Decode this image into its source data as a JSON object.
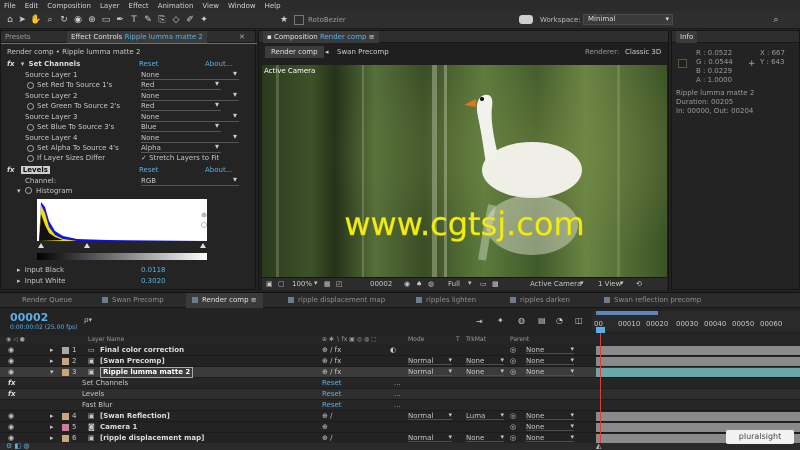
{
  "menu": [
    "File",
    "Edit",
    "Composition",
    "Layer",
    "Effect",
    "Animation",
    "View",
    "Window",
    "Help"
  ],
  "toolbar": {
    "roto_label": "RotoBezier",
    "workspace_label": "Workspace:",
    "workspace_value": "Minimal"
  },
  "effect_controls": {
    "tab_presets": "Presets",
    "tab_title": "Effect Controls",
    "tab_layer": "Ripple lumma matte 2",
    "breadcrumb": "Render comp • Ripple lumma matte 2",
    "set_channels": {
      "name": "Set Channels",
      "reset": "Reset",
      "about": "About...",
      "rows": [
        {
          "label": "Source Layer 1",
          "value": "None"
        },
        {
          "label": "Set Red To Source 1's",
          "value": "Red"
        },
        {
          "label": "Source Layer 2",
          "value": "None"
        },
        {
          "label": "Set Green To Source 2's",
          "value": "Red"
        },
        {
          "label": "Source Layer 3",
          "value": "None"
        },
        {
          "label": "Set Blue To Source 3's",
          "value": "Blue"
        },
        {
          "label": "Source Layer 4",
          "value": "None"
        },
        {
          "label": "Set Alpha To Source 4's",
          "value": "Alpha"
        },
        {
          "label": "If Layer Sizes Differ",
          "value": "✓ Stretch Layers to Fit"
        }
      ]
    },
    "levels": {
      "name": "Levels",
      "reset": "Reset",
      "about": "About...",
      "channel_label": "Channel:",
      "channel_value": "RGB",
      "histogram_label": "Histogram",
      "input_black_label": "Input Black",
      "input_black_value": "0.0118",
      "input_white_label": "Input White",
      "input_white_value": "0.3020"
    }
  },
  "composition": {
    "tab_label": "Composition",
    "tab_comp": "Render comp",
    "sub_tab_active": "Render comp",
    "sub_tab_other": "Swan Precomp",
    "renderer_label": "Renderer:",
    "renderer_value": "Classic 3D",
    "active_camera_overlay": "Active Camera",
    "watermark": "www.cgtsj.com",
    "zoom": "100%",
    "frame": "00002",
    "resolution": "Full",
    "camera": "Active Camera",
    "views": "1 View"
  },
  "info": {
    "tab_label": "Info",
    "r": "R : 0.0522",
    "g": "G : 0.0544",
    "b": "B : 0.0229",
    "a": "A : 1.0000",
    "x": "X : 667",
    "y": "Y : 643",
    "layer_name": "Ripple lumma matte 2",
    "duration": "Duration: 00205",
    "in_out": "In: 00000, Out: 00204"
  },
  "timeline": {
    "tabs": [
      {
        "label": "Render Queue",
        "color": ""
      },
      {
        "label": "Swan Precomp",
        "color": "#6f7a8a"
      },
      {
        "label": "Render comp",
        "color": "#6f7a8a",
        "active": true
      },
      {
        "label": "ripple displacement map",
        "color": "#6f7a8a"
      },
      {
        "label": "ripples lighten",
        "color": "#6f7a8a"
      },
      {
        "label": "ripples darken",
        "color": "#6f7a8a"
      },
      {
        "label": "Swan reflection precomp",
        "color": "#6f7a8a"
      }
    ],
    "timecode": "00002",
    "timecode_sub": "0:00:00:02 (25.00 fps)",
    "search_placeholder": "ρ▾",
    "ruler": [
      "00",
      "00010",
      "00020",
      "00030",
      "00040",
      "00050",
      "00060"
    ],
    "headers": {
      "layer_name": "Layer Name",
      "mode": "Mode",
      "t": "T",
      "trkmat": "TrkMat",
      "parent": "Parent"
    },
    "layers": [
      {
        "num": "1",
        "name": "Final color correction",
        "mode": "",
        "trkmat": "",
        "parent": "None",
        "color": "#a8a8a8",
        "bar": "#8a8a8a"
      },
      {
        "num": "2",
        "name": "[Swan Precomp]",
        "mode": "Normal",
        "trkmat": "None",
        "parent": "None",
        "color": "#c9a57d",
        "bar": "#8a8a8a"
      },
      {
        "num": "3",
        "name": "Ripple lumma matte 2",
        "mode": "Normal",
        "trkmat": "None",
        "parent": "None",
        "color": "#c9a57d",
        "bar": "#6aa8a8",
        "selected": true
      },
      {
        "num": "4",
        "name": "[Swan Reflection]",
        "mode": "Normal",
        "trkmat": "Luma",
        "parent": "None",
        "color": "#c9a57d",
        "bar": "#8a8a8a"
      },
      {
        "num": "5",
        "name": "Camera 1",
        "mode": "",
        "trkmat": "",
        "parent": "None",
        "color": "#c77f9a",
        "bar": "#8a8a8a"
      },
      {
        "num": "6",
        "name": "[ripple displacement map]",
        "mode": "Normal",
        "trkmat": "None",
        "parent": "None",
        "color": "#c9a57d",
        "bar": "#8a8a8a"
      }
    ],
    "sub_effects": [
      {
        "name": "Set Channels",
        "reset": "Reset",
        "dots": "..."
      },
      {
        "name": "Levels",
        "reset": "Reset",
        "dots": "..."
      },
      {
        "name": "Fast Blur",
        "reset": "Reset",
        "dots": "..."
      }
    ]
  },
  "pluralsight": "pluralsight"
}
